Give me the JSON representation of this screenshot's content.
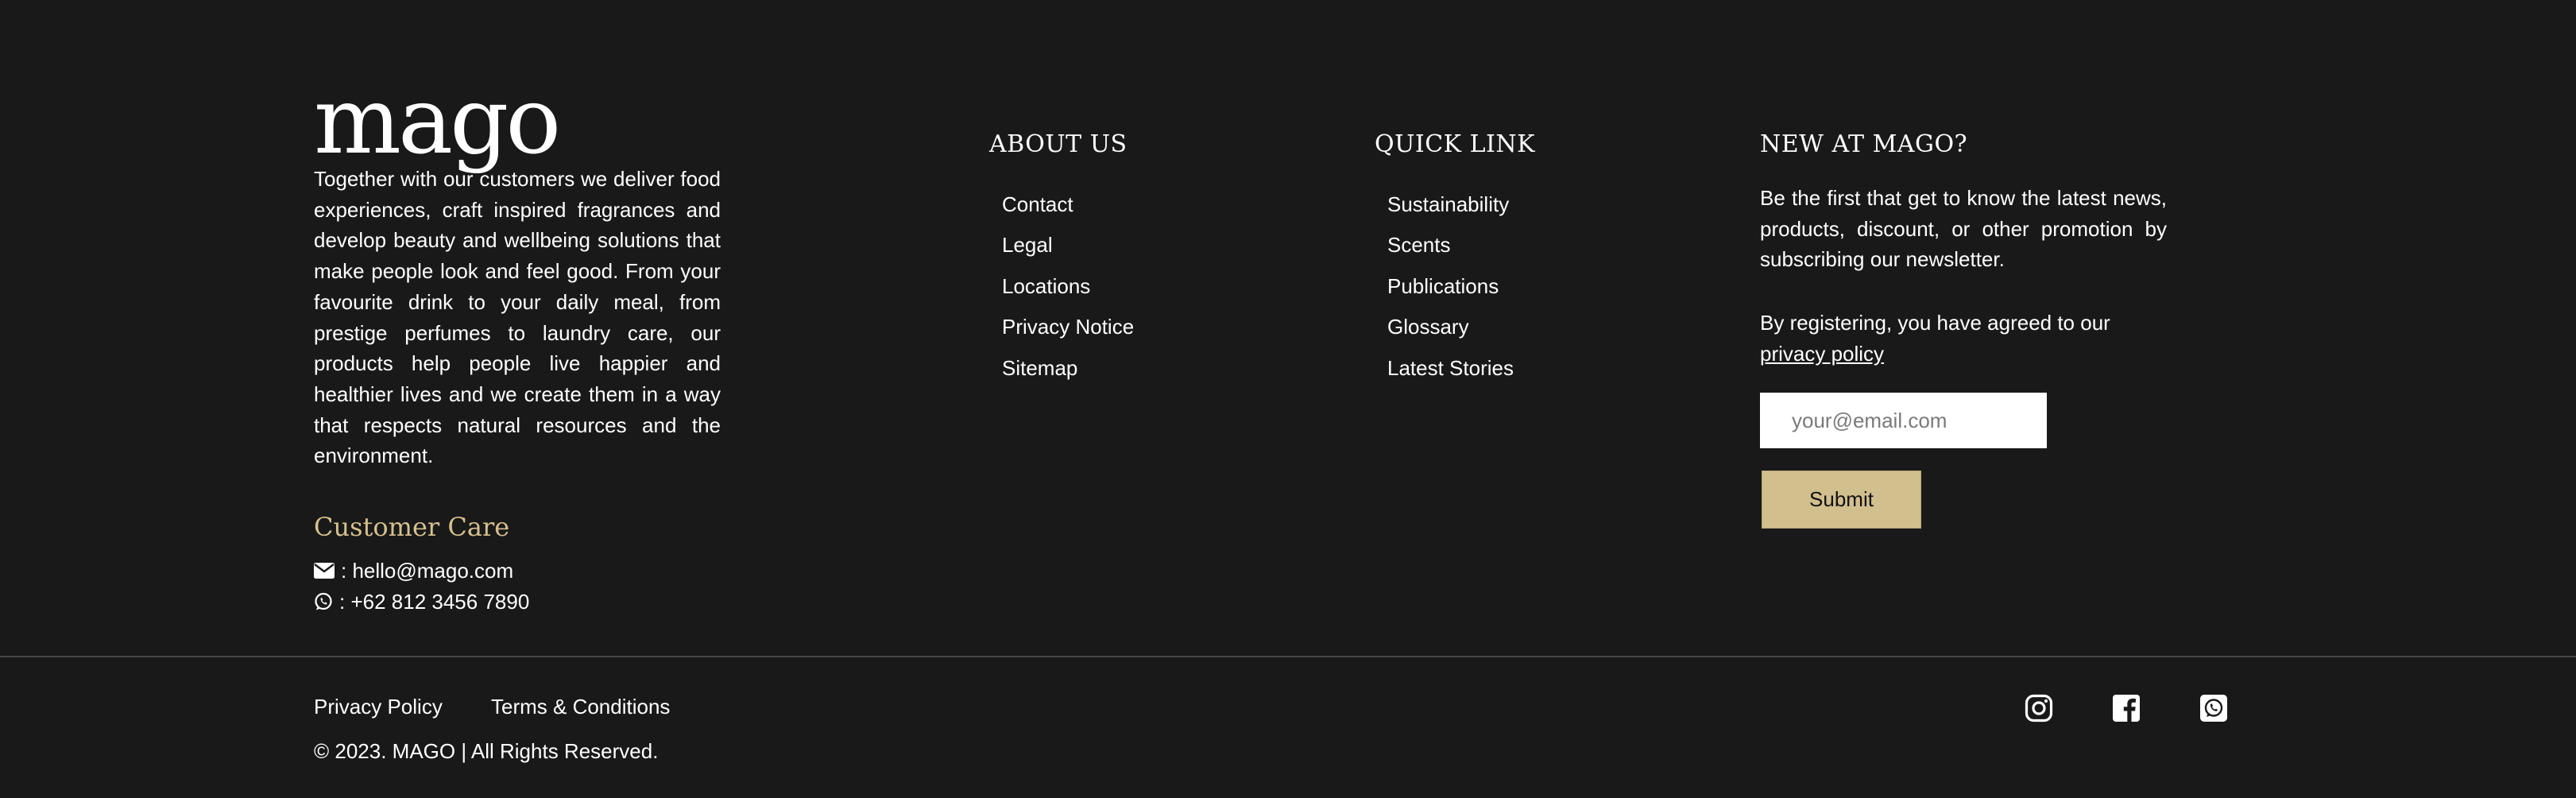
{
  "brand": {
    "logo_text": "mago",
    "description": "Together with our customers we deliver food experiences, craft inspired fragrances and develop beauty and wellbeing solutions that make people look and feel good. From your favourite drink to your daily meal, from prestige perfumes to laundry care, our products help people live happier and healthier lives and we create them in a way that respects natural resources and the environment."
  },
  "customer_care": {
    "title": "Customer Care",
    "email": ": hello@mago.com",
    "phone": ": +62 812 3456 7890",
    "email_icon": "envelope-icon",
    "phone_icon": "whatsapp-icon"
  },
  "about_us": {
    "title": "ABOUT US",
    "items": [
      "Contact",
      "Legal",
      "Locations",
      "Privacy Notice",
      "Sitemap"
    ]
  },
  "quick_link": {
    "title": "QUICK LINK",
    "items": [
      "Sustainability",
      "Scents",
      "Publications",
      "Glossary",
      "Latest Stories"
    ]
  },
  "newsletter": {
    "title": "NEW AT MAGO?",
    "text": "Be the first that get to know the latest news, products, discount, or other promotion by subscribing our newsletter.",
    "agree_text": "By registering, you have agreed to our",
    "privacy_link": "privacy policy",
    "email_placeholder": "your@email.com",
    "submit_label": "Submit"
  },
  "bottom_bar": {
    "privacy_policy": "Privacy Policy",
    "terms": "Terms & Conditions",
    "copyright": "© 2023. MAGO | All Rights Reserved.",
    "social_icons": [
      "instagram-icon",
      "facebook-icon",
      "whatsapp-icon"
    ]
  },
  "colors": {
    "background": "#191919",
    "accent": "#d2bf8e",
    "text": "#ffffff",
    "divider": "#474747"
  }
}
